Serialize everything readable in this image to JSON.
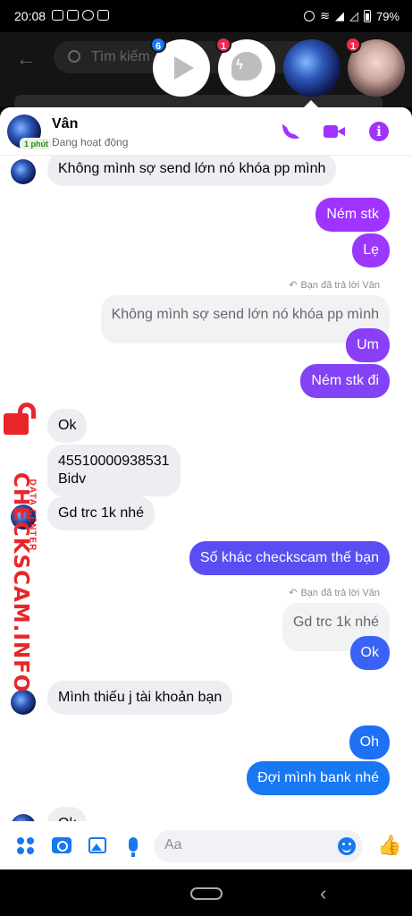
{
  "status_bar": {
    "time": "20:08",
    "battery": "79%"
  },
  "search": {
    "placeholder": "Tìm kiếm"
  },
  "chat_heads": [
    {
      "name": "video",
      "badge": "6"
    },
    {
      "name": "messenger",
      "badge": "1"
    },
    {
      "name": "space-avatar",
      "badge": ""
    },
    {
      "name": "girl-avatar",
      "badge": "1"
    }
  ],
  "header": {
    "name": "Vân",
    "status": "Đang hoạt động",
    "last_seen": "1 phút"
  },
  "messages": [
    {
      "id": "m1",
      "dir": "in",
      "text": "Không mình sợ send lớn nó khóa pp mình"
    },
    {
      "id": "m2",
      "dir": "out",
      "text": "Ném stk"
    },
    {
      "id": "m3",
      "dir": "out",
      "text": "Lẹ"
    },
    {
      "id": "m4",
      "dir": "note",
      "text": "Bạn đã trả lời Vân"
    },
    {
      "id": "m5",
      "dir": "quoted",
      "text": "Không mình sợ send lớn nó khóa pp mình"
    },
    {
      "id": "m6",
      "dir": "out",
      "text": "Um"
    },
    {
      "id": "m7",
      "dir": "out",
      "text": "Ném stk đi"
    },
    {
      "id": "m8",
      "dir": "in",
      "text": "Ok"
    },
    {
      "id": "m9",
      "dir": "in",
      "text": "45510000938531"
    },
    {
      "id": "m9b",
      "dir": "in",
      "text": "Bidv"
    },
    {
      "id": "m10",
      "dir": "in",
      "text": "Gd trc 1k nhé"
    },
    {
      "id": "m11",
      "dir": "out",
      "text": "Số khác checkscam thế bạn"
    },
    {
      "id": "m12",
      "dir": "note",
      "text": "Bạn đã trả lời Vân"
    },
    {
      "id": "m13",
      "dir": "quoted",
      "text": "Gd trc 1k nhé"
    },
    {
      "id": "m14",
      "dir": "out",
      "text": "Ok"
    },
    {
      "id": "m15",
      "dir": "in",
      "text": "Mình thiếu j tài khoản bạn"
    },
    {
      "id": "m16",
      "dir": "out",
      "text": "Oh"
    },
    {
      "id": "m17",
      "dir": "out",
      "text": "Đợi mình bank nhé"
    },
    {
      "id": "m18",
      "dir": "in",
      "text": "Ok"
    }
  ],
  "composer": {
    "placeholder": "Aa"
  },
  "watermark": {
    "brand": "CHECKSCAM.INFO",
    "sub": "DATA CENTER"
  },
  "colors": {
    "outgoing_top": "#a033ff",
    "outgoing_bottom": "#1877f2",
    "incoming": "#eceef1",
    "accent": "#1877f2"
  }
}
